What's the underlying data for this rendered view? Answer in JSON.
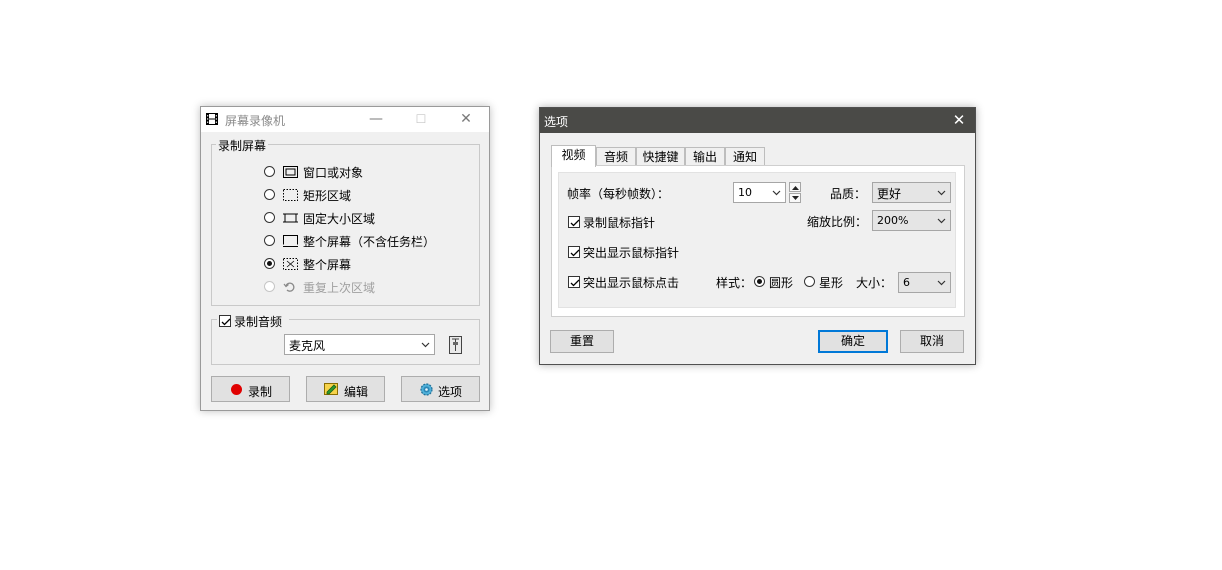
{
  "recorder": {
    "title": "屏幕录像机",
    "minimize": "—",
    "maximize": "☐",
    "close": "✕",
    "screen_group": "录制屏幕",
    "modes": [
      {
        "label": "窗口或对象",
        "icon": "window-icon",
        "selected": false,
        "disabled": false
      },
      {
        "label": "矩形区域",
        "icon": "rectangle-region-icon",
        "selected": false,
        "disabled": false
      },
      {
        "label": "固定大小区域",
        "icon": "fixed-size-region-icon",
        "selected": false,
        "disabled": false
      },
      {
        "label": "整个屏幕（不含任务栏）",
        "icon": "screen-no-taskbar-icon",
        "selected": false,
        "disabled": false
      },
      {
        "label": "整个屏幕",
        "icon": "full-screen-icon",
        "selected": true,
        "disabled": false
      },
      {
        "label": "重复上次区域",
        "icon": "repeat-last-region-icon",
        "selected": false,
        "disabled": true
      }
    ],
    "audio_group": "录制音频",
    "audio_checked": true,
    "audio_source": "麦克风",
    "record_button": "录制",
    "edit_button": "编辑",
    "options_button": "选项"
  },
  "options": {
    "title": "选项",
    "close": "✕",
    "tabs": [
      "视频",
      "音频",
      "快捷键",
      "输出",
      "通知"
    ],
    "active_tab": 0,
    "framerate_label": "帧率（每秒帧数）：",
    "framerate_value": "10",
    "quality_label": "品质：",
    "quality_value": "更好",
    "record_pointer_label": "录制鼠标指针",
    "record_pointer_checked": true,
    "scale_label": "缩放比例：",
    "scale_value": "200%",
    "highlight_pointer_label": "突出显示鼠标指针",
    "highlight_pointer_checked": true,
    "highlight_click_label": "突出显示鼠标点击",
    "highlight_click_checked": true,
    "style_label": "样式：",
    "style_circle": "圆形",
    "style_star": "星形",
    "style_selected": "circle",
    "size_label": "大小：",
    "size_value": "6",
    "reset_button": "重置",
    "ok_button": "确定",
    "cancel_button": "取消"
  },
  "colors": {
    "record_dot": "#e00000",
    "accent": "#0078d7",
    "dark_titlebar": "#4a4a47"
  }
}
